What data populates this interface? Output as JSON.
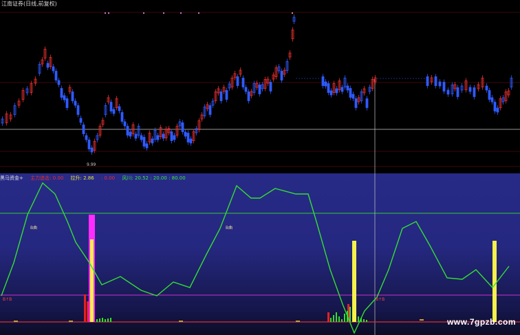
{
  "window": {
    "title": "江南证券(日线,前复权)"
  },
  "price_chart": {
    "low_label": "9.99",
    "colors": {
      "up": "#e8302f",
      "down": "#2f5bff",
      "grid": "#3a0a0a",
      "crosshair": "#c8c8c8"
    }
  },
  "indicator": {
    "name": "黑马资金+",
    "items": [
      {
        "label": "主力追击:",
        "value": "0.00",
        "color": "#e8302f"
      },
      {
        "label": "拉升:",
        "value": "2.86",
        "color": "#e8e830"
      },
      {
        "label": "",
        "value": ": 0.00",
        "color": "#e8302f"
      },
      {
        "label": "风川:",
        "value": "20.52 : 20.00 : 80.00",
        "color": "#3de83d"
      }
    ],
    "markers": [
      "B曲",
      "B曲",
      "B↑B",
      "B↑B"
    ],
    "colors": {
      "line": "#32e032",
      "upper_level": "#2fd02f",
      "lower_level": "#d030d0",
      "yellow_bar": "#f5f04a",
      "magenta_bar": "#ff2bff",
      "red_bar": "#e82020",
      "green_bar": "#30e030"
    }
  },
  "watermark": "www.7gpzb.com"
}
